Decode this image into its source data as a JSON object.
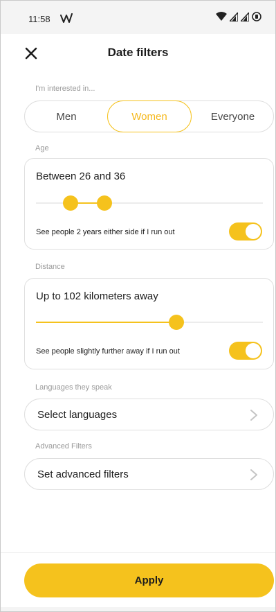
{
  "status_bar": {
    "time": "11:58",
    "app_icon": "activity-wave-icon",
    "right_icons": [
      "wifi-icon",
      "signal-icon",
      "signal-icon",
      "battery-saver-icon"
    ]
  },
  "header": {
    "close_icon": "close-icon",
    "title": "Date filters"
  },
  "interest": {
    "label": "I'm interested in...",
    "options": [
      "Men",
      "Women",
      "Everyone"
    ],
    "selected": "Women"
  },
  "age": {
    "label": "Age",
    "title": "Between 26 and 36",
    "range": [
      26,
      36
    ],
    "toggle_label": "See people 2 years either side if I run out",
    "toggle_on": true
  },
  "distance": {
    "label": "Distance",
    "title": "Up to 102 kilometers away",
    "value_km": 102,
    "toggle_label": "See people slightly further away if I run out",
    "toggle_on": true
  },
  "languages": {
    "label": "Languages they speak",
    "button": "Select languages"
  },
  "advanced": {
    "label": "Advanced Filters",
    "button": "Set advanced filters"
  },
  "footer": {
    "apply": "Apply"
  },
  "colors": {
    "accent": "#f5c21d",
    "text": "#1d1d1d",
    "muted": "#9a9a9a",
    "border": "#dedede"
  }
}
